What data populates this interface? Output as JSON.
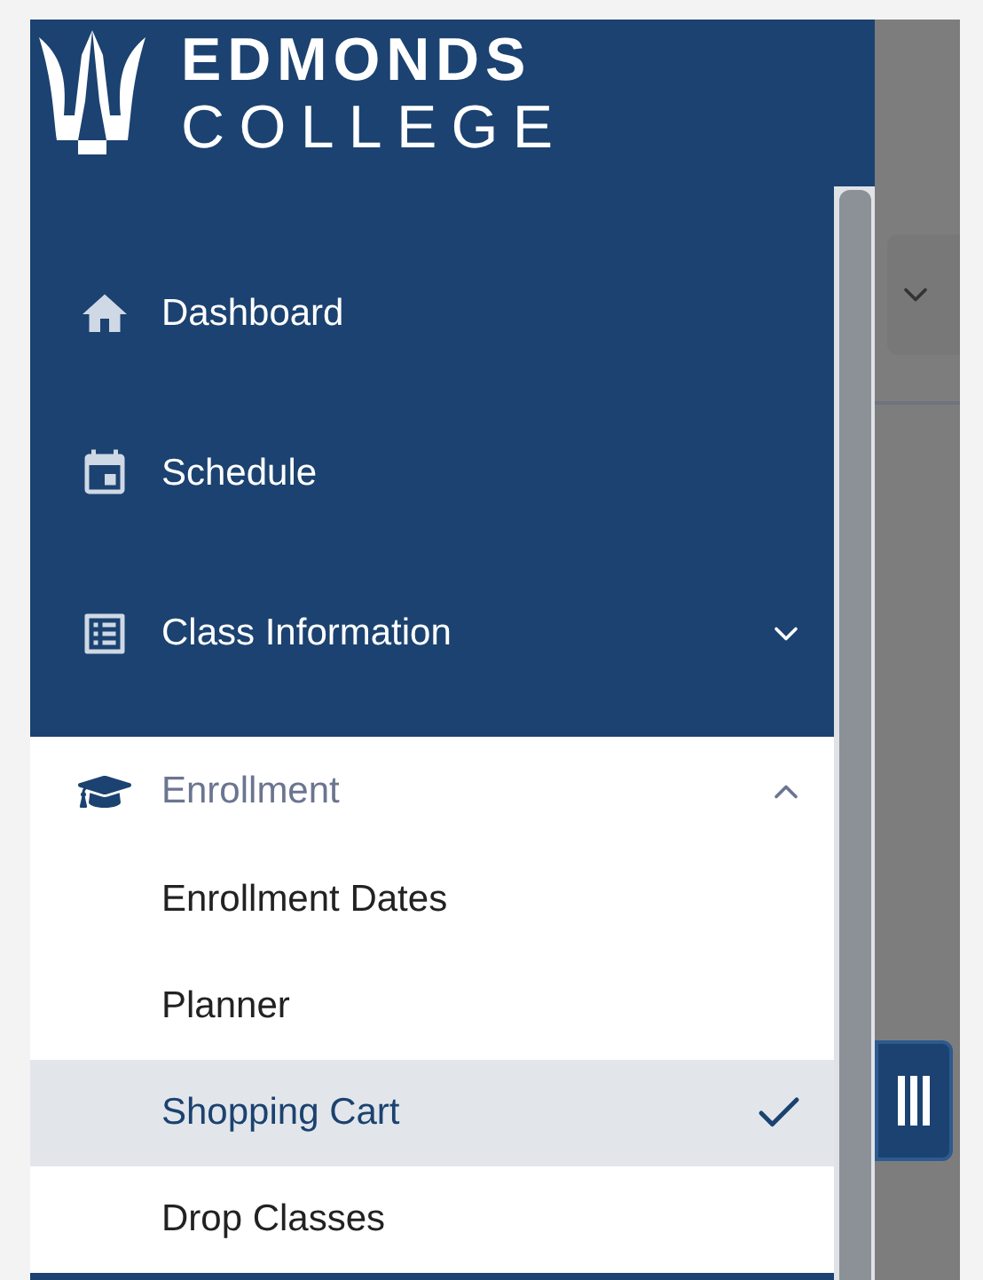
{
  "logo": {
    "line_1": "EDMONDS",
    "line_2": "COLLEGE"
  },
  "nav": [
    {
      "label": "Dashboard",
      "kind": "home",
      "expandable": false,
      "expanded": false
    },
    {
      "label": "Schedule",
      "kind": "calendar",
      "expandable": false,
      "expanded": false
    },
    {
      "label": "Class Information",
      "kind": "list",
      "expandable": true,
      "expanded": false
    },
    {
      "label": "Enrollment",
      "kind": "cap",
      "expandable": true,
      "expanded": true,
      "children": [
        {
          "label": "Enrollment Dates",
          "selected": false
        },
        {
          "label": "Planner",
          "selected": false
        },
        {
          "label": "Shopping Cart",
          "selected": true
        },
        {
          "label": "Drop Classes",
          "selected": false
        }
      ]
    }
  ]
}
